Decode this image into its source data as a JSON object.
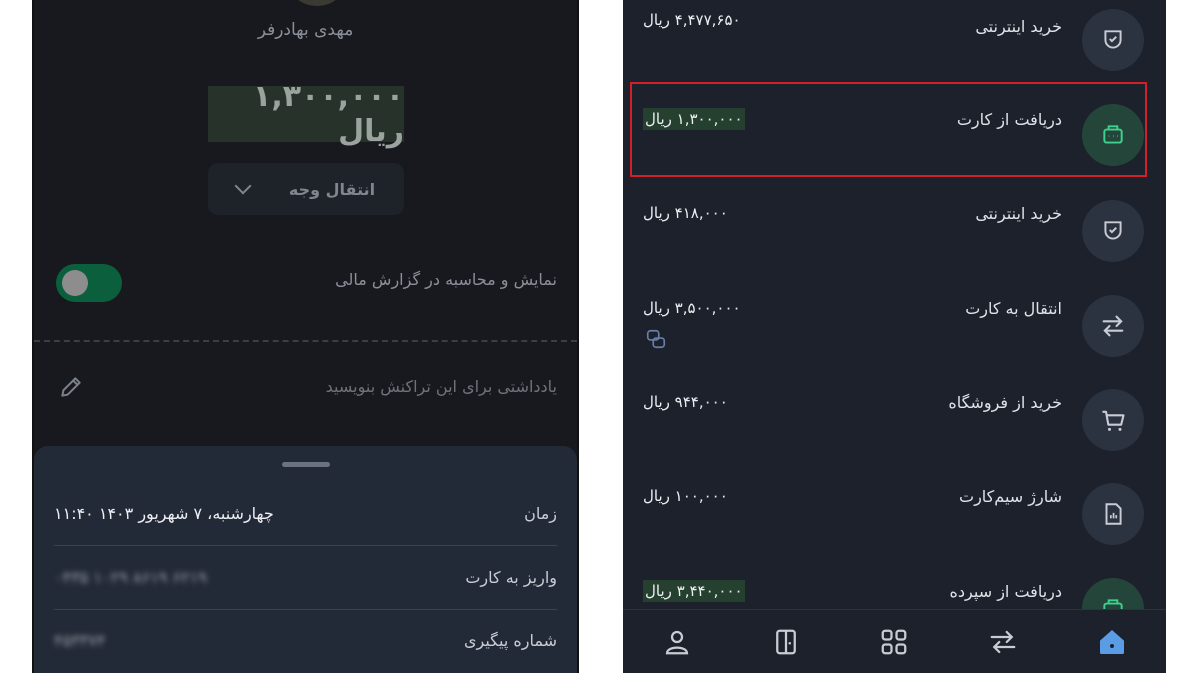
{
  "left": {
    "user_name": "مهدی بهادرفر",
    "amount": "۱,۳۰۰,۰۰۰ ریال",
    "transfer_button": "انتقال وجه",
    "toggle_label": "نمایش و محاسبه در گزارش مالی",
    "toggle_on": true,
    "note_placeholder": "یادداشتی برای این تراکنش بنویسید",
    "details": [
      {
        "label": "زمان",
        "value": "چهارشنبه، ۷ شهریور ۱۴۰۳ ۱۱:۴۰"
      },
      {
        "label": "واریز به کارت",
        "value": "۶۲۱۹ ۸۶۱۹ ۱۰۲۹ ۰۴۳۵"
      },
      {
        "label": "شماره پیگیری",
        "value": "۴۵۳۳۷۴"
      }
    ]
  },
  "right": {
    "transactions": [
      {
        "title": "خرید اینترنتی",
        "amount": "۴,۴۷۷,۶۵۰ ریال",
        "icon": "internet-icon"
      },
      {
        "title": "دریافت از کارت",
        "amount": "۱,۳۰۰,۰۰۰ ریال",
        "icon": "card-receive-icon",
        "highlighted": true
      },
      {
        "title": "خرید اینترنتی",
        "amount": "۴۱۸,۰۰۰ ریال",
        "icon": "internet-icon"
      },
      {
        "title": "انتقال به کارت",
        "amount": "۳,۵۰۰,۰۰۰ ریال",
        "icon": "transfer-icon"
      },
      {
        "title": "خرید از فروشگاه",
        "amount": "۹۴۴,۰۰۰ ریال",
        "icon": "cart-icon"
      },
      {
        "title": "شارژ سیم‌کارت",
        "amount": "۱۰۰,۰۰۰ ریال",
        "icon": "sim-card-icon"
      },
      {
        "title": "دریافت از سپرده",
        "amount": "۳,۴۴۰,۰۰۰ ریال",
        "icon": "deposit-icon"
      }
    ],
    "nav_items": [
      "profile-icon",
      "card-icon",
      "services-grid-icon",
      "transactions-icon",
      "home-icon"
    ]
  },
  "colors": {
    "highlight_border": "#d21f2a",
    "accent_blue": "#5a9de6",
    "accent_green": "#3fcf8e"
  }
}
